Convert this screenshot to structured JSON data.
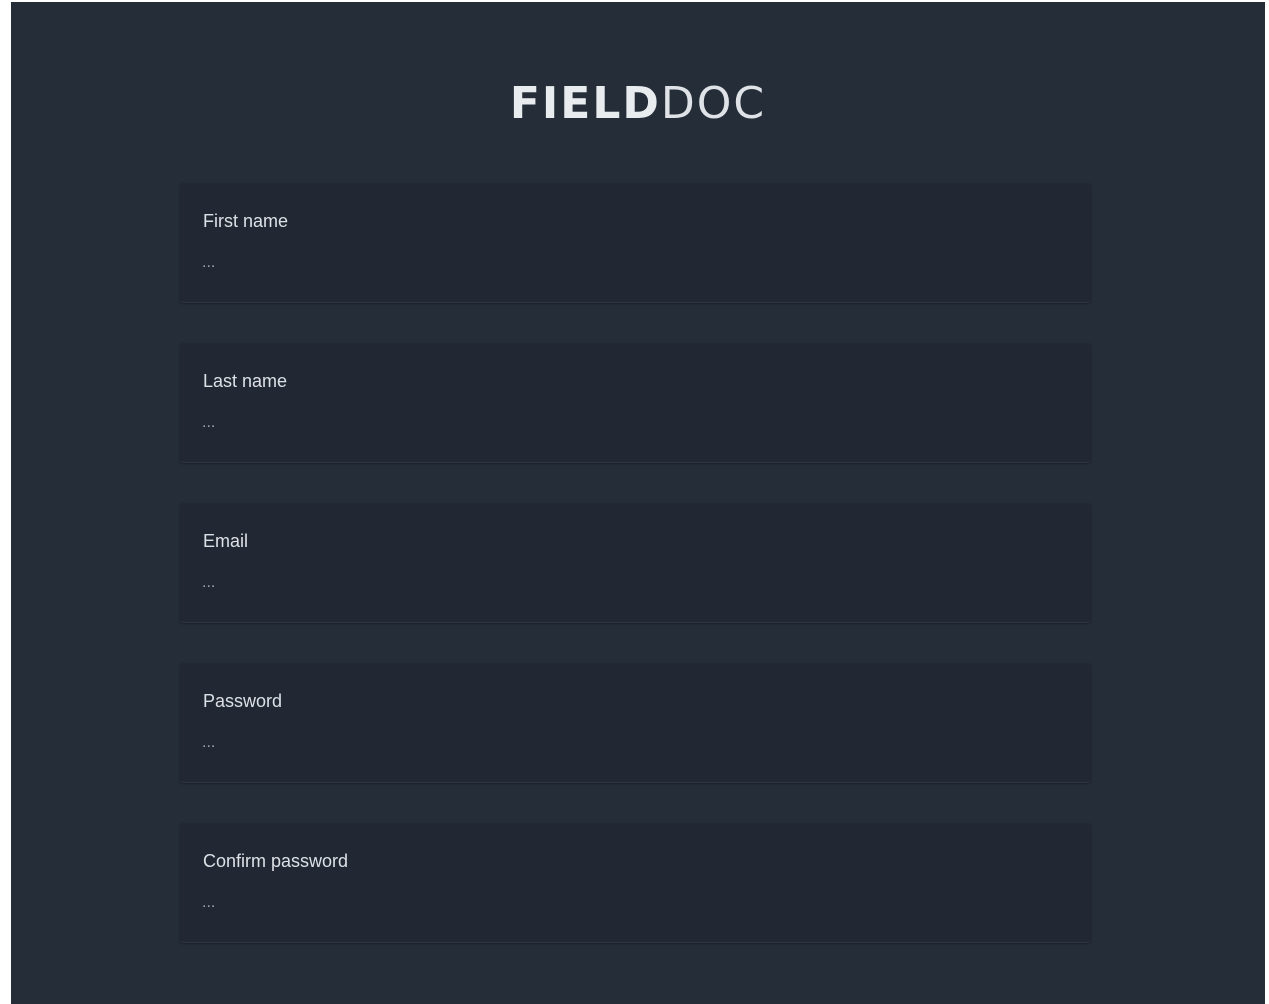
{
  "logo": {
    "bold": "FIELD",
    "light": "DOC"
  },
  "form": {
    "fields": [
      {
        "label": "First name",
        "placeholder": "...",
        "value": ""
      },
      {
        "label": "Last name",
        "placeholder": "...",
        "value": ""
      },
      {
        "label": "Email",
        "placeholder": "...",
        "value": ""
      },
      {
        "label": "Password",
        "placeholder": "...",
        "value": ""
      },
      {
        "label": "Confirm password",
        "placeholder": "...",
        "value": ""
      }
    ]
  }
}
